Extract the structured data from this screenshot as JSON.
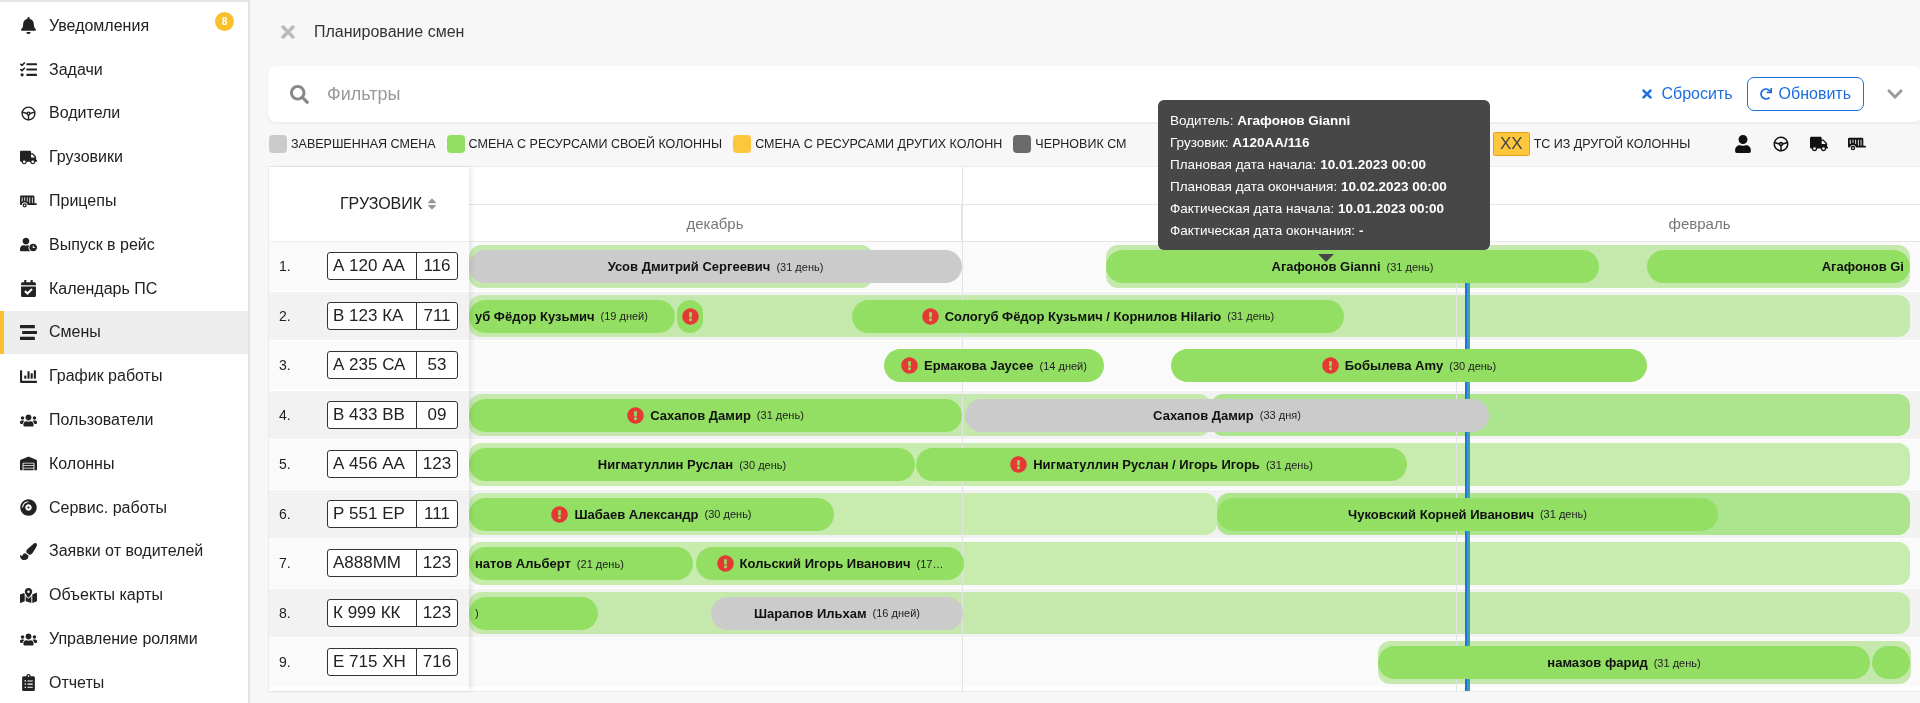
{
  "sidebar": {
    "items": [
      {
        "label": "Уведомления",
        "badge": "8",
        "selected": false
      },
      {
        "label": "Задачи",
        "selected": false
      },
      {
        "label": "Водители",
        "selected": false
      },
      {
        "label": "Грузовики",
        "selected": false
      },
      {
        "label": "Прицепы",
        "selected": false
      },
      {
        "label": "Выпуск в рейс",
        "selected": false
      },
      {
        "label": "Календарь ПС",
        "selected": false
      },
      {
        "label": "Смены",
        "selected": true
      },
      {
        "label": "График работы",
        "selected": false
      },
      {
        "label": "Пользователи",
        "selected": false
      },
      {
        "label": "Колонны",
        "selected": false
      },
      {
        "label": "Сервис. работы",
        "selected": false
      },
      {
        "label": "Заявки от водителей",
        "selected": false
      },
      {
        "label": "Объекты карты",
        "selected": false
      },
      {
        "label": "Управление ролями",
        "selected": false
      },
      {
        "label": "Отчеты",
        "selected": false
      }
    ]
  },
  "header": {
    "title": "Планирование смен"
  },
  "filters": {
    "placeholder": "Фильтры",
    "reset": "Сбросить",
    "refresh": "Обновить"
  },
  "legend": [
    {
      "kind": "swatch",
      "label": "ЗАВЕРШЕННАЯ СМЕНА",
      "color": "#cbcbcb"
    },
    {
      "kind": "swatch",
      "label": "СМЕНА С РЕСУРСАМИ СВОЕЙ КОЛОННЫ",
      "color": "#93df63"
    },
    {
      "kind": "swatch",
      "label": "СМЕНА С РЕСУРСАМИ ДРУГИХ КОЛОНН",
      "color": "#fdc63d"
    },
    {
      "kind": "swatch",
      "label": "ЧЕРНОВИК СМ",
      "color": "#6b6b6b"
    },
    {
      "kind": "plate",
      "region": "XX",
      "label": "ТС ИЗ ДРУГОЙ КОЛОННЫ"
    }
  ],
  "gantt": {
    "column_header": "ГРУЗОВИК",
    "months": [
      {
        "label": "декабрь"
      },
      {
        "label": "февраль"
      }
    ],
    "rows": [
      {
        "index": "1.",
        "plate": {
          "number": "А 120 АА",
          "region": "116"
        },
        "bars": [
          {
            "kind": "completed",
            "name": "Усов Дмитрий Сергеевич",
            "duration": "(31 день)",
            "problem": false
          },
          {
            "kind": "own",
            "name": "Агафонов Gianni",
            "duration": "(31 день)",
            "problem": false
          },
          {
            "kind": "own",
            "name": "Агафонов Gi",
            "problem": false
          }
        ]
      },
      {
        "index": "2.",
        "plate": {
          "number": "В 123 КА",
          "region": "711"
        },
        "bars": [
          {
            "kind": "own",
            "name": "уб Фёдор Кузьмич",
            "duration": "(19 дней)",
            "problem": false
          },
          {
            "kind": "own",
            "problem": true
          },
          {
            "kind": "own",
            "name": "Сологуб Фёдор Кузьмич / Корнилов Hilario",
            "duration": "(31 день)",
            "problem": true
          }
        ]
      },
      {
        "index": "3.",
        "plate": {
          "number": "А 235 СА",
          "region": "53"
        },
        "bars": [
          {
            "kind": "own",
            "name": "Ермакова Jaycee",
            "duration": "(14 дней)",
            "problem": true
          },
          {
            "kind": "own",
            "name": "Бобылева Amy",
            "duration": "(30 день)",
            "problem": true
          }
        ]
      },
      {
        "index": "4.",
        "plate": {
          "number": "В 433 ВВ",
          "region": "09"
        },
        "bars": [
          {
            "kind": "own",
            "name": "Сахапов Дамир",
            "duration": "(31 день)",
            "problem": true
          },
          {
            "kind": "completed",
            "name": "Сахапов Дамир",
            "duration": "(33 дня)",
            "problem": false
          }
        ]
      },
      {
        "index": "5.",
        "plate": {
          "number": "А 456 АА",
          "region": "123"
        },
        "bars": [
          {
            "kind": "own",
            "name": "Нигматуллин Руслан",
            "duration": "(30 день)",
            "problem": false
          },
          {
            "kind": "own",
            "name": "Нигматуллин Руслан  / Игорь Игорь",
            "duration": "(31 день)",
            "problem": true
          }
        ]
      },
      {
        "index": "6.",
        "plate": {
          "number": "Р 551 ЕР",
          "region": "111"
        },
        "bars": [
          {
            "kind": "own",
            "name": "Шабаев Александр",
            "duration": "(30 день)",
            "problem": true
          },
          {
            "kind": "own",
            "name": "Чуковский Корней Иванович",
            "duration": "(31 день)",
            "problem": false
          }
        ]
      },
      {
        "index": "7.",
        "plate": {
          "number": "А888ММ",
          "region": "123"
        },
        "bars": [
          {
            "kind": "own",
            "name": "натов Альберт",
            "duration": "(21 день)",
            "problem": false
          },
          {
            "kind": "own",
            "name": "Кольский Игорь Иванович",
            "duration": "(17…",
            "problem": true
          }
        ]
      },
      {
        "index": "8.",
        "plate": {
          "number": "К 999 КК",
          "region": "123"
        },
        "bars": [
          {
            "kind": "own",
            "duration": ")",
            "problem": false
          },
          {
            "kind": "completed",
            "name": "Шарапов Ильхам",
            "duration": "(16 дней)",
            "problem": false
          }
        ]
      },
      {
        "index": "9.",
        "plate": {
          "number": "Е 715 ХН",
          "region": "716"
        },
        "bars": [
          {
            "kind": "own",
            "name": "намазов фарид",
            "duration": "(31 день)",
            "problem": false
          },
          {
            "kind": "own",
            "problem": false
          }
        ]
      }
    ]
  },
  "tooltip": {
    "lines": [
      "Водитель: **Агафонов Gianni**",
      "Грузовик: **А120АА/116**",
      "Плановая дата начала: **10.01.2023 00:00**",
      "Плановая дата окончания: **10.02.2023 00:00**",
      "Фактическая дата начала: **10.01.2023 00:00**",
      "Фактическая дата окончания: **-**"
    ]
  }
}
